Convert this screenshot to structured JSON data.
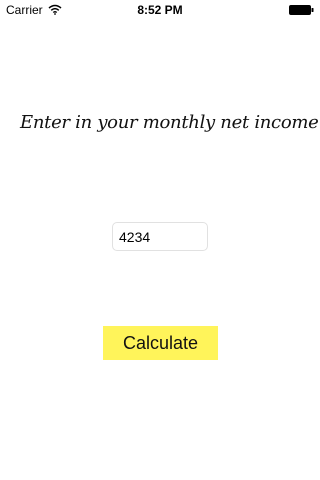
{
  "status_bar": {
    "carrier": "Carrier",
    "time": "8:52 PM",
    "wifi_icon": "wifi-icon",
    "battery_icon": "battery-icon"
  },
  "main": {
    "prompt": "Enter in your monthly net income",
    "income_input_value": "4234",
    "calculate_label": "Calculate"
  },
  "colors": {
    "button_background": "#fff45a",
    "input_border": "#e1e1e1",
    "cursor": "#2b6cf6"
  }
}
